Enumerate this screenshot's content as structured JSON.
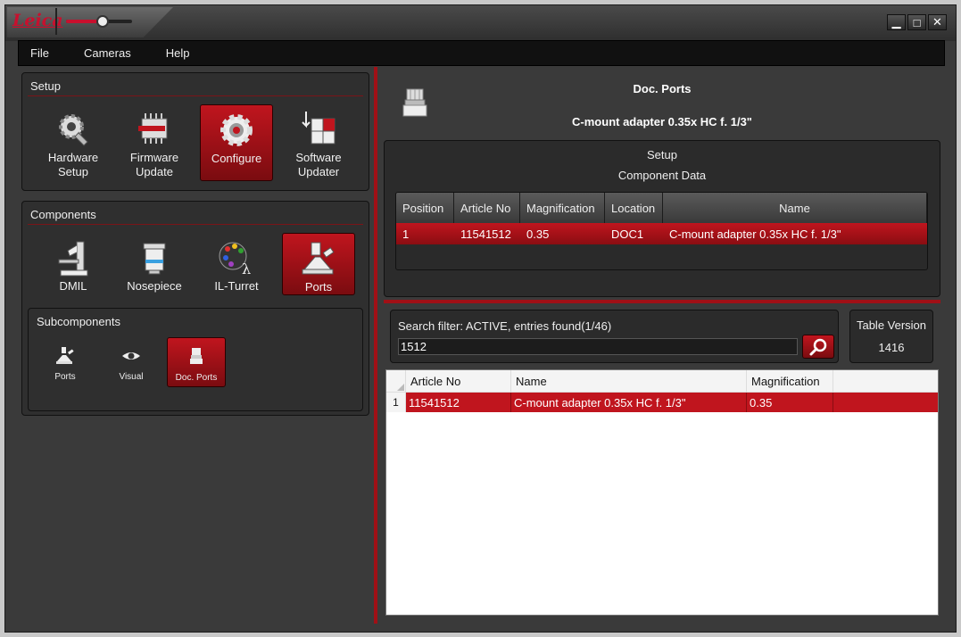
{
  "app": {
    "logo_text": "Leica"
  },
  "window_controls": {
    "minimize": "▁",
    "maximize": "□",
    "close": "✕"
  },
  "zoom_slider": {
    "level": 0.55
  },
  "menu": [
    "File",
    "Cameras",
    "Help"
  ],
  "setup": {
    "title": "Setup",
    "items": [
      {
        "line1": "Hardware",
        "line2": "Setup",
        "icon": "hardware-setup-icon",
        "active": false
      },
      {
        "line1": "Firmware",
        "line2": "Update",
        "icon": "firmware-chip-icon",
        "active": false
      },
      {
        "line1": "Configure",
        "line2": "",
        "icon": "gear-icon",
        "active": true
      },
      {
        "line1": "Software",
        "line2": "Updater",
        "icon": "software-updater-icon",
        "active": false
      }
    ]
  },
  "components": {
    "title": "Components",
    "items": [
      {
        "label": "DMIL",
        "icon": "microscope-icon",
        "active": false
      },
      {
        "label": "Nosepiece",
        "icon": "nosepiece-icon",
        "active": false
      },
      {
        "label": "IL-Turret",
        "icon": "il-turret-icon",
        "active": false
      },
      {
        "label": "Ports",
        "icon": "ports-icon",
        "active": true
      }
    ]
  },
  "subcomponents": {
    "title": "Subcomponents",
    "items": [
      {
        "label": "Ports",
        "icon": "ports-icon",
        "active": false
      },
      {
        "label": "Visual",
        "icon": "eye-icon",
        "active": false
      },
      {
        "label": "Doc. Ports",
        "icon": "doc-port-icon",
        "active": true
      }
    ]
  },
  "detail": {
    "title": "Doc. Ports",
    "subtitle": "C-mount adapter 0.35x HC f. 1/3\"",
    "section_line1": "Setup",
    "section_line2": "Component Data",
    "columns": [
      "Position",
      "Article No",
      "Magnification",
      "Location",
      "Name"
    ],
    "rows": [
      {
        "position": "1",
        "article": "11541512",
        "magnification": "0.35",
        "location": "DOC1",
        "name": "C-mount adapter 0.35x HC f. 1/3\""
      }
    ]
  },
  "search": {
    "label": "Search filter: ACTIVE, entries found(1/46)",
    "value": "1512",
    "button_icon": "search-icon"
  },
  "table_version": {
    "label": "Table Version",
    "value": "1416"
  },
  "results": {
    "columns": [
      "Article No",
      "Name",
      "Magnification"
    ],
    "rows": [
      {
        "index": "1",
        "article": "11541512",
        "name": "C-mount adapter 0.35x HC f. 1/3\"",
        "magnification": "0.35"
      }
    ]
  },
  "colors": {
    "accent": "#c0151e",
    "panel": "#2f2f2f",
    "background": "#3a3a3a"
  }
}
